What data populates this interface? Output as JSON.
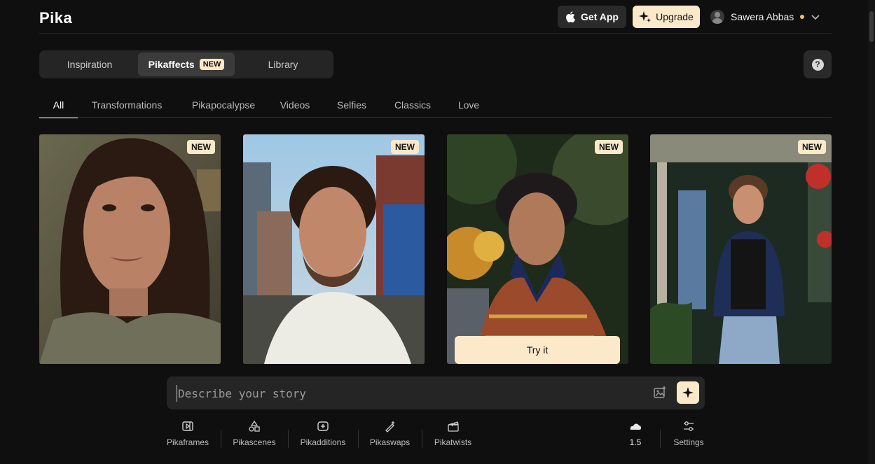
{
  "header": {
    "logo": "Pika",
    "get_app_label": "Get App",
    "upgrade_label": "Upgrade",
    "user_name": "Sawera Abbas"
  },
  "main_tabs": [
    {
      "label": "Inspiration"
    },
    {
      "label": "Pikaffects",
      "badge": "NEW",
      "active": true
    },
    {
      "label": "Library"
    }
  ],
  "help_label": "?",
  "categories": [
    {
      "label": "All",
      "active": true
    },
    {
      "label": "Transformations"
    },
    {
      "label": "Pikapocalypse"
    },
    {
      "label": "Videos"
    },
    {
      "label": "Selfies"
    },
    {
      "label": "Classics"
    },
    {
      "label": "Love"
    }
  ],
  "cards": [
    {
      "badge": "NEW"
    },
    {
      "badge": "NEW"
    },
    {
      "badge": "NEW",
      "cta": "Try it"
    },
    {
      "badge": "NEW"
    }
  ],
  "prompt": {
    "placeholder": "Describe your story"
  },
  "tools": [
    {
      "label": "Pikaframes",
      "icon": "frame-icon"
    },
    {
      "label": "Pikascenes",
      "icon": "shapes-icon"
    },
    {
      "label": "Pikadditions",
      "icon": "add-frame-icon"
    },
    {
      "label": "Pikaswaps",
      "icon": "wand-icon"
    },
    {
      "label": "Pikatwists",
      "icon": "clapper-icon"
    }
  ],
  "model_version": "1.5",
  "settings_label": "Settings",
  "colors": {
    "background": "#0f0f0f",
    "accent_cream": "#fbe9c9",
    "panel": "#252525",
    "status_dot": "#f2c15a"
  }
}
